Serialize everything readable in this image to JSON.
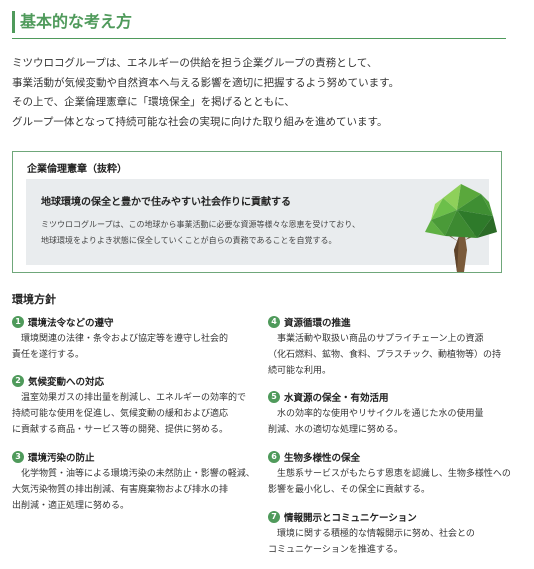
{
  "header": {
    "title": "基本的な考え方"
  },
  "intro": {
    "lines": [
      "ミツウロコグループは、エネルギーの供給を担う企業グループの責務として、",
      "事業活動が気候変動や自然資本へ与える影響を適切に把握するよう努めています。",
      "その上で、企業倫理憲章に「環境保全」を掲げるとともに、",
      "グループ一体となって持続可能な社会の実現に向けた取り組みを進めています。"
    ]
  },
  "charter": {
    "title": "企業倫理憲章（抜粋）",
    "heading": "地球環境の保全と豊かで住みやすい社会作りに貢献する",
    "lines": [
      "ミツウロコグループは、この地球から事業活動に必要な資源等様々な恩恵を受けており、",
      "地球環境をよりよき状態に保全していくことが自らの責務であることを自覚する。"
    ]
  },
  "policy": {
    "title": "環境方針",
    "items": [
      {
        "num": "1",
        "title": "環境法令などの遵守",
        "lines": [
          "環境関連の法律・条令および協定等を遵守し社会的",
          "責任を遂行する。"
        ]
      },
      {
        "num": "2",
        "title": "気候変動への対応",
        "lines": [
          "温室効果ガスの排出量を削減し、エネルギーの効率的で",
          "持続可能な使用を促進し、気候変動の緩和および適応",
          "に貢献する商品・サービス等の開発、提供に努める。"
        ]
      },
      {
        "num": "3",
        "title": "環境汚染の防止",
        "lines": [
          "化学物質・油等による環境汚染の未然防止・影響の軽減、",
          "大気汚染物質の排出削減、有害廃棄物および排水の排",
          "出削減・適正処理に努める。"
        ]
      },
      {
        "num": "4",
        "title": "資源循環の推進",
        "lines": [
          "事業活動や取扱い商品のサプライチェーン上の資源",
          "（化石燃料、鉱物、食料、プラスチック、動植物等）の持",
          "続可能な利用。"
        ]
      },
      {
        "num": "5",
        "title": "水資源の保全・有効活用",
        "lines": [
          "水の効率的な使用やリサイクルを通じた水の使用量",
          "削減、水の適切な処理に努める。"
        ]
      },
      {
        "num": "6",
        "title": "生物多様性の保全",
        "lines": [
          "生態系サービスがもたらす恩恵を認識し、生物多様性への",
          "影響を最小化し、その保全に貢献する。"
        ]
      },
      {
        "num": "7",
        "title": "情報開示とコミュニケーション",
        "lines": [
          "環境に関する積極的な情報開示に努め、社会との",
          "コミュニケーションを推進する。"
        ]
      }
    ]
  },
  "colors": {
    "accent": "#4f9a5b",
    "panel": "#e9ecee",
    "border": "#6fa77a"
  }
}
